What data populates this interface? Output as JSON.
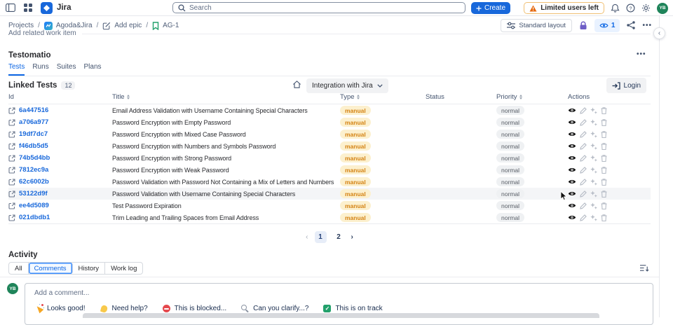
{
  "topbar": {
    "app_name": "Jira",
    "search_placeholder": "Search",
    "create_label": "Create",
    "warning_label": "Limited users left",
    "avatar_initials": "YB"
  },
  "breadcrumb": {
    "separator": "/",
    "projects": "Projects",
    "project": "Agoda&Jira",
    "add_epic": "Add epic",
    "issue": "AG-1"
  },
  "view_toolbar": {
    "standard_layout_label": "Standard layout",
    "watchers_count": "1",
    "more_label": "•••"
  },
  "right_rail": {
    "collapse_glyph": "‹"
  },
  "related": {
    "label": "Add related work item"
  },
  "testomatio": {
    "title": "Testomatio",
    "more_label": "•••",
    "tabs": [
      "Tests",
      "Runs",
      "Suites",
      "Plans"
    ],
    "active_tab": "Tests",
    "linked_label": "Linked Tests",
    "linked_count": "12",
    "integration_button": "Integration with Jira",
    "login_button": "Login",
    "table": {
      "headers": {
        "id": "Id",
        "title": "Title",
        "type": "Type",
        "status": "Status",
        "priority": "Priority",
        "actions": "Actions"
      },
      "rows": [
        {
          "id": "6a447516",
          "title": "Email Address Validation with Username Containing Special Characters",
          "type": "manual",
          "priority": "normal"
        },
        {
          "id": "a706a977",
          "title": "Password Encryption with Empty Password",
          "type": "manual",
          "priority": "normal"
        },
        {
          "id": "19df7dc7",
          "title": "Password Encryption with Mixed Case Password",
          "type": "manual",
          "priority": "normal"
        },
        {
          "id": "f46db5d5",
          "title": "Password Encryption with Numbers and Symbols Password",
          "type": "manual",
          "priority": "normal"
        },
        {
          "id": "74b5d4bb",
          "title": "Password Encryption with Strong Password",
          "type": "manual",
          "priority": "normal"
        },
        {
          "id": "7812ec9a",
          "title": "Password Encryption with Weak Password",
          "type": "manual",
          "priority": "normal"
        },
        {
          "id": "62c6002b",
          "title": "Password Validation with Password Not Containing a Mix of Letters and Numbers",
          "type": "manual",
          "priority": "normal"
        },
        {
          "id": "53122d9f",
          "title": "Password Validation with Username Containing Special Characters",
          "type": "manual",
          "priority": "normal",
          "highlight": true
        },
        {
          "id": "ee4d5089",
          "title": "Test Password Expiration",
          "type": "manual",
          "priority": "normal"
        },
        {
          "id": "021dbdb1",
          "title": "Trim Leading and Trailing Spaces from Email Address",
          "type": "manual",
          "priority": "normal"
        }
      ]
    },
    "pagination": {
      "prev": "‹",
      "pages": [
        "1",
        "2"
      ],
      "current": "1",
      "next": "›"
    }
  },
  "activity": {
    "title": "Activity",
    "tabs": [
      "All",
      "Comments",
      "History",
      "Work log"
    ],
    "active_tab": "Comments",
    "comment_placeholder": "Add a comment...",
    "quick_replies": [
      {
        "icon": "party",
        "label": "Looks good!"
      },
      {
        "icon": "wave",
        "label": "Need help?"
      },
      {
        "icon": "blocked",
        "label": "This is blocked..."
      },
      {
        "icon": "magnifier",
        "label": "Can you clarify...?"
      },
      {
        "icon": "check",
        "label": "This is on track"
      }
    ]
  },
  "colors": {
    "accent_blue": "#1868DB",
    "link_blue": "#1868DB",
    "active_tab_blue": "#0C66E4",
    "manual_badge_bg": "#FCF0CE",
    "manual_badge_text": "#D48314",
    "status_green": "#3DC794",
    "priority_pill_bg": "#EFF1F3",
    "warning_orange": "#E56910",
    "lock_purple": "#6E5DC6",
    "avatar_green": "#1F845A",
    "watch_chip_bg": "#E9F2FF"
  }
}
